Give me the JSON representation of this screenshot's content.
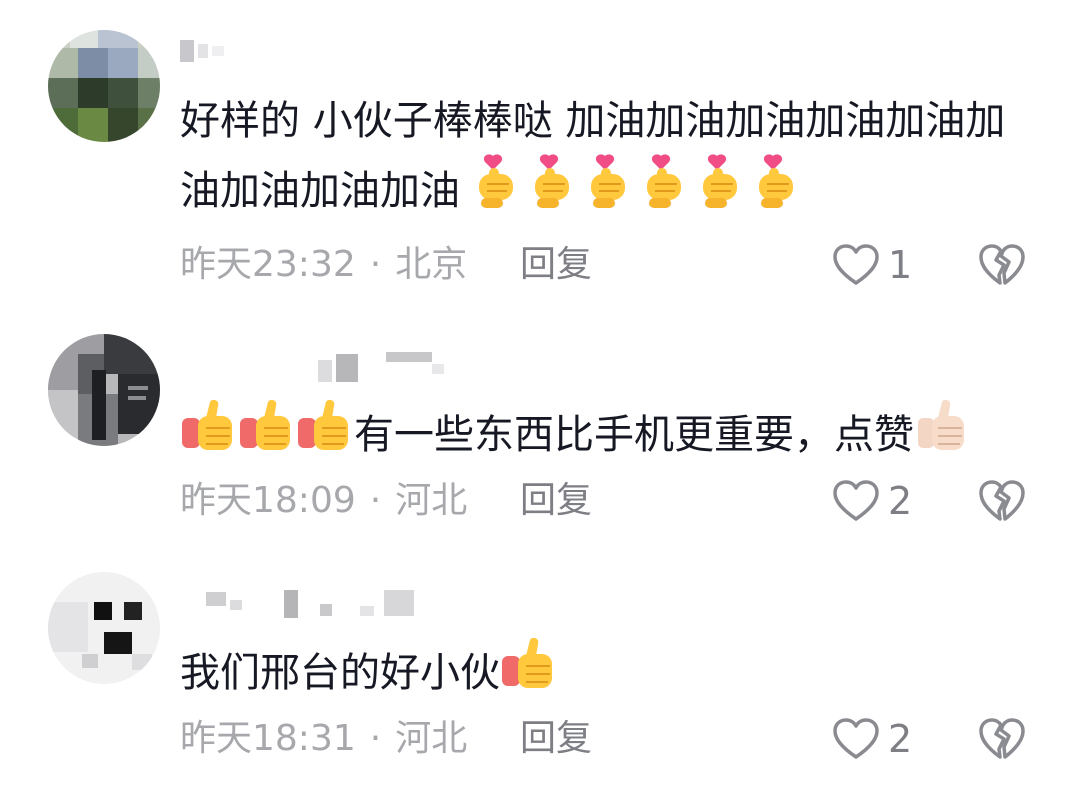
{
  "comments": [
    {
      "username": "",
      "content": "好样的 小伙子棒棒哒 加油加油加油加油加油加油加油加油加油",
      "emojis": [
        "heart-hands",
        "heart-hands",
        "heart-hands",
        "heart-hands",
        "heart-hands",
        "heart-hands"
      ],
      "time": "昨天23:32",
      "location": "北京",
      "reply_label": "回复",
      "like_count": "1"
    },
    {
      "username": "",
      "content_prefix_emojis": [
        "thumbs-up",
        "thumbs-up",
        "thumbs-up"
      ],
      "content": "有一些东西比手机更重要，点赞",
      "content_suffix_emoji": "thumbs-up-light",
      "time": "昨天18:09",
      "location": "河北",
      "reply_label": "回复",
      "like_count": "2"
    },
    {
      "username": "",
      "content": "我们邢台的好小伙",
      "content_suffix_emoji": "thumbs-up",
      "time": "昨天18:31",
      "location": "河北",
      "reply_label": "回复",
      "like_count": "2"
    }
  ],
  "colors": {
    "text": "#161823",
    "meta": "#a7a8ac",
    "action": "#7e7f85"
  },
  "icons": {
    "like": "heart-outline-icon",
    "dislike": "broken-heart-icon"
  }
}
